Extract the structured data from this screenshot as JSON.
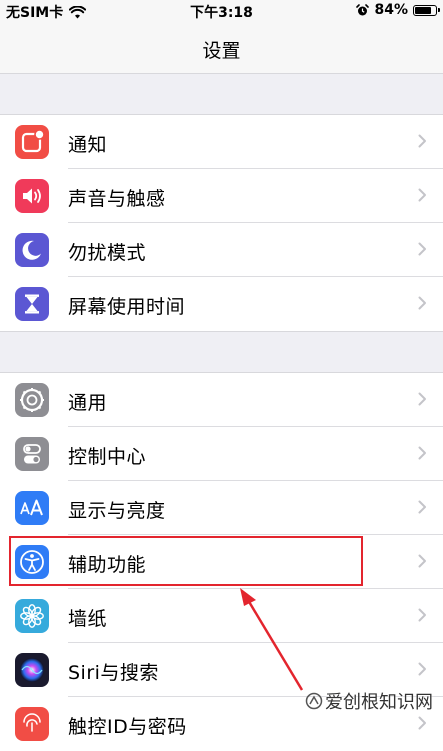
{
  "status_bar": {
    "carrier": "无SIM卡",
    "time": "下午3:18",
    "battery": "84%",
    "battery_level": 0.84
  },
  "nav": {
    "title": "设置"
  },
  "groups": [
    {
      "items": [
        {
          "label": "通知",
          "icon": "notifications-icon",
          "color": "#f14d45"
        },
        {
          "label": "声音与触感",
          "icon": "sound-icon",
          "color": "#f03a5a"
        },
        {
          "label": "勿扰模式",
          "icon": "moon-icon",
          "color": "#5b57d3"
        },
        {
          "label": "屏幕使用时间",
          "icon": "hourglass-icon",
          "color": "#5b57d3"
        }
      ]
    },
    {
      "items": [
        {
          "label": "通用",
          "icon": "gear-icon",
          "color": "#8e8e93"
        },
        {
          "label": "控制中心",
          "icon": "toggles-icon",
          "color": "#8e8e93"
        },
        {
          "label": "显示与亮度",
          "icon": "text-size-icon",
          "color": "#2f7cf6"
        },
        {
          "label": "辅助功能",
          "icon": "accessibility-icon",
          "color": "#2f7cf6"
        },
        {
          "label": "墙纸",
          "icon": "flower-icon",
          "color": "#36aadc"
        },
        {
          "label": "Siri与搜索",
          "icon": "siri-icon",
          "color": "#1a1a2e"
        },
        {
          "label": "触控ID与密码",
          "icon": "fingerprint-icon",
          "color": "#f14d45"
        }
      ]
    }
  ],
  "watermark": {
    "text": "爱创根知识网"
  }
}
